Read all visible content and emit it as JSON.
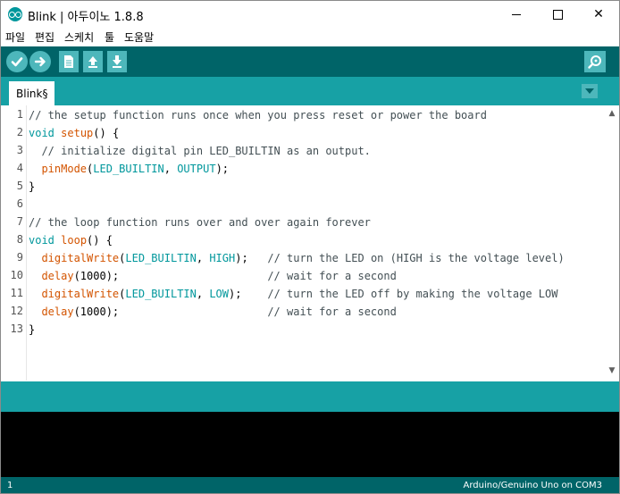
{
  "window": {
    "title": "Blink | 아두이노 1.8.8",
    "controls": {
      "minimize": "minimize",
      "maximize": "maximize",
      "close": "✕"
    }
  },
  "menu": {
    "items": [
      "파일",
      "편집",
      "스케치",
      "툴",
      "도움말"
    ]
  },
  "toolbar": {
    "buttons": [
      {
        "name": "verify",
        "icon": "check-icon"
      },
      {
        "name": "upload",
        "icon": "arrow-right-icon"
      },
      {
        "name": "new",
        "icon": "new-file-icon"
      },
      {
        "name": "open",
        "icon": "arrow-up-icon"
      },
      {
        "name": "save",
        "icon": "arrow-down-icon"
      }
    ],
    "serial_monitor_icon": "magnifier-icon"
  },
  "tabs": [
    {
      "label": "Blink§"
    }
  ],
  "editor": {
    "line_numbers": [
      "1",
      "2",
      "3",
      "4",
      "5",
      "6",
      "7",
      "8",
      "9",
      "10",
      "11",
      "12",
      "13"
    ],
    "lines": [
      "// the setup function runs once when you press reset or power the board",
      "void setup() {",
      "  // initialize digital pin LED_BUILTIN as an output.",
      "  pinMode(LED_BUILTIN, OUTPUT);",
      "}",
      "",
      "// the loop function runs over and over again forever",
      "void loop() {",
      "  digitalWrite(LED_BUILTIN, HIGH);   // turn the LED on (HIGH is the voltage level)",
      "  delay(1000);                       // wait for a second",
      "  digitalWrite(LED_BUILTIN, LOW);    // turn the LED off by making the voltage LOW",
      "  delay(1000);                       // wait for a second",
      "}"
    ]
  },
  "footer": {
    "line": "1",
    "board": "Arduino/Genuino Uno on COM3"
  },
  "colors": {
    "toolbar": "#006468",
    "tabbar": "#17a1a5",
    "button": "#4db7bb",
    "keyword": "#00979c",
    "function": "#d35400",
    "comment": "#434f54"
  }
}
